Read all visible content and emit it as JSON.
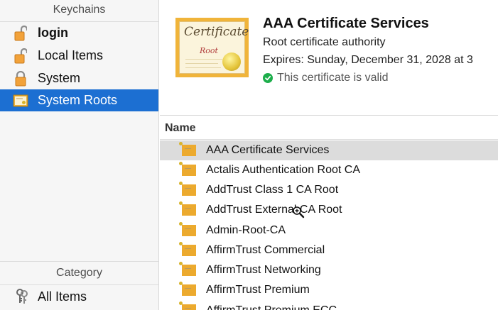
{
  "sidebar": {
    "keychains_header": "Keychains",
    "keychains": [
      {
        "label": "login",
        "icon": "lock-open-icon"
      },
      {
        "label": "Local Items",
        "icon": "lock-open-icon"
      },
      {
        "label": "System",
        "icon": "lock-icon"
      },
      {
        "label": "System Roots",
        "icon": "certificate-icon",
        "selected": true
      }
    ],
    "category_header": "Category",
    "categories": [
      {
        "label": "All Items",
        "icon": "keys-icon"
      }
    ]
  },
  "detail": {
    "title": "AAA Certificate Services",
    "subtitle": "Root certificate authority",
    "expires": "Expires: Sunday, December 31, 2028 at 3",
    "validity": "This certificate is valid",
    "cert_image_text": "Certificate",
    "cert_image_subtext": "Root"
  },
  "list": {
    "column_header": "Name",
    "rows": [
      "AAA Certificate Services",
      "Actalis Authentication Root CA",
      "AddTrust Class 1 CA Root",
      "AddTrust External CA Root",
      "Admin-Root-CA",
      "AffirmTrust Commercial",
      "AffirmTrust Networking",
      "AffirmTrust Premium",
      "AffirmTrust Premium ECC"
    ]
  },
  "colors": {
    "selection": "#1c6fd2",
    "row_selection": "#dcdcdc",
    "valid_green": "#1dae4b"
  }
}
